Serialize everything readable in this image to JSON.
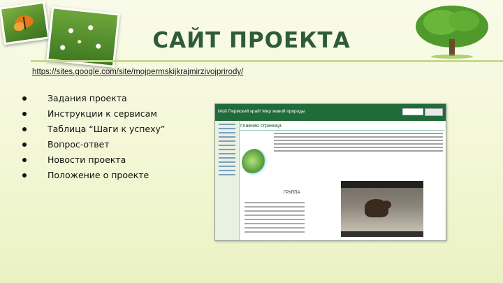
{
  "slide": {
    "title": "САЙТ ПРОЕКТА",
    "url": "https://sites.google.com/site/mojpermskijkrajmirzivojprirody/",
    "bullets": [
      {
        "label": "Задания проекта"
      },
      {
        "label": "Инструкции к сервисам"
      },
      {
        "label": "Таблица “Шаги к успеху”"
      },
      {
        "label": "Вопрос-ответ"
      },
      {
        "label": "Новости проекта"
      },
      {
        "label": "Положение о проекте"
      }
    ]
  },
  "site_screenshot": {
    "site_name": "Мой Пермский край! Мир живой природы",
    "page_title": "Главная страница",
    "subheading": "ГРУППА"
  },
  "decor": {
    "icons": [
      "butterfly-photo-icon",
      "daisies-photo-icon",
      "tree-icon",
      "bear-video-thumbnail-icon"
    ]
  }
}
